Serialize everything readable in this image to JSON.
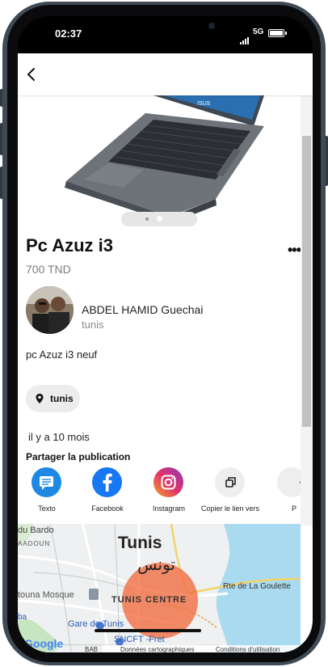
{
  "status_bar": {
    "time": "02:37",
    "network": "5G"
  },
  "listing": {
    "title": "Pc Azuz i3",
    "price": "700 TND",
    "description": "pc Azuz i3 neuf",
    "location_chip": "tunis",
    "posted": "il y a 10 mois",
    "carousel": {
      "count": 2,
      "active_index": 1
    }
  },
  "seller": {
    "name": "ABDEL HAMID Guechai",
    "city": "tunis"
  },
  "share": {
    "title": "Partager la publication",
    "items": [
      {
        "label": "Texto",
        "icon": "message-icon",
        "color": "#1e88e5"
      },
      {
        "label": "Facebook",
        "icon": "facebook-icon",
        "color": "#1877f2"
      },
      {
        "label": "Instagram",
        "icon": "instagram-icon",
        "color": "#e1306c"
      },
      {
        "label": "Copier le lien vers",
        "icon": "copy-icon",
        "color": "#eeeeee"
      },
      {
        "label": "P",
        "icon": "more-share-icon",
        "color": "#eeeeee"
      }
    ]
  },
  "map": {
    "labels": {
      "bardo": "du Bardo",
      "saadoun": "AADOUN",
      "tunis": "Tunis",
      "tunis_ar": "تونس",
      "tunis_centre": "TUNIS CENTRE",
      "zitouna": "touna Mosque",
      "gare": "Gare de Tunis",
      "sncft": "SNCFT -Fret",
      "route": "Rte de La Goulette",
      "bab": "BAB",
      "ba": "ba"
    },
    "footer": {
      "data": "Données cartographiques",
      "terms": "Conditions d'utilisation"
    },
    "google": "Google"
  }
}
